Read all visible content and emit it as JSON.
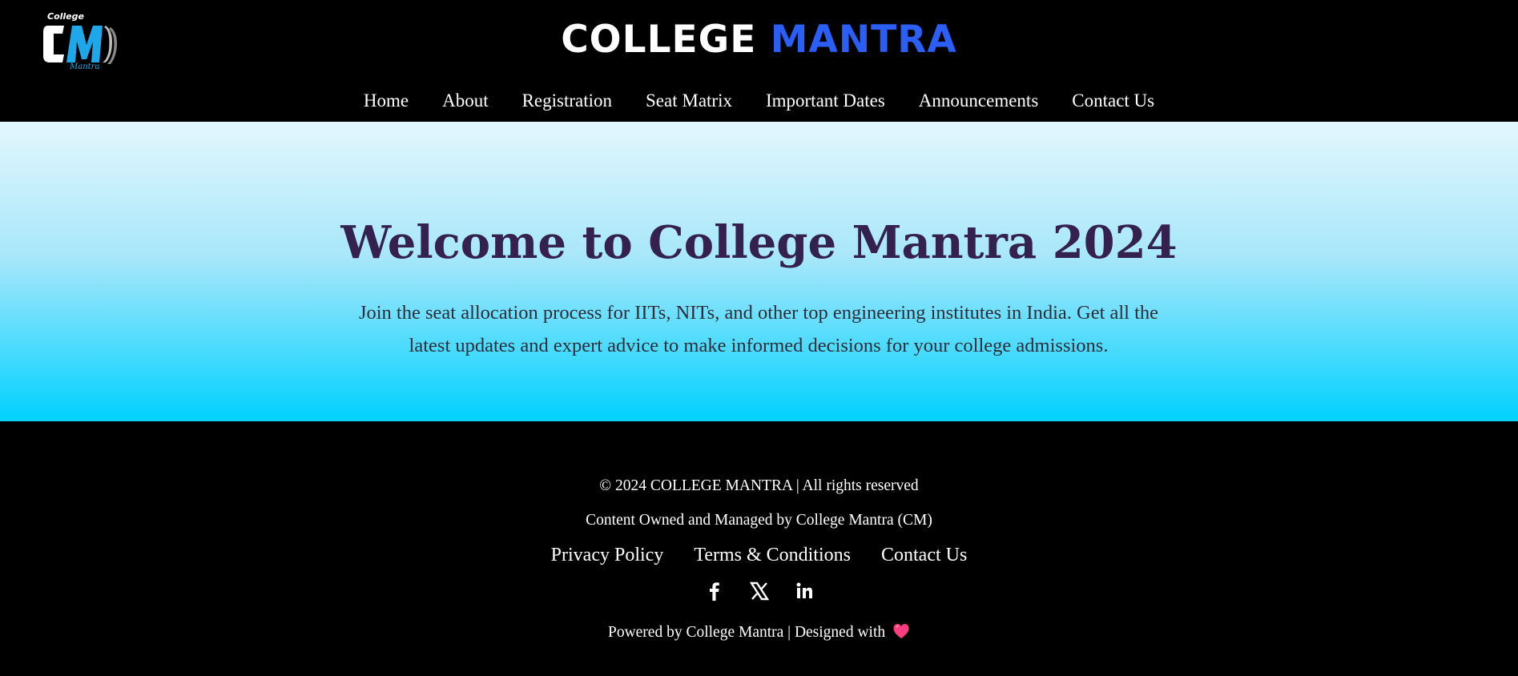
{
  "header": {
    "logo": {
      "small_top": "College",
      "letters": "CM",
      "small_bottom": "Mantra"
    },
    "title_part1": "COLLEGE",
    "title_part2": "MANTRA",
    "nav": [
      {
        "label": "Home"
      },
      {
        "label": "About"
      },
      {
        "label": "Registration"
      },
      {
        "label": "Seat Matrix"
      },
      {
        "label": "Important Dates"
      },
      {
        "label": "Announcements"
      },
      {
        "label": "Contact Us"
      }
    ]
  },
  "hero": {
    "heading": "Welcome to College Mantra 2024",
    "description": "Join the seat allocation process for IITs, NITs, and other top engineering institutes in India. Get all the latest updates and expert advice to make informed decisions for your college admissions."
  },
  "footer": {
    "copyright": "© 2024 COLLEGE MANTRA | All rights reserved",
    "owned": "Content Owned and Managed by College Mantra (CM)",
    "links": [
      {
        "label": "Privacy Policy"
      },
      {
        "label": "Terms & Conditions"
      },
      {
        "label": "Contact Us"
      }
    ],
    "social": [
      {
        "icon": "facebook-icon"
      },
      {
        "icon": "x-icon"
      },
      {
        "icon": "linkedin-icon"
      }
    ],
    "powered": "Powered by College Mantra | Designed with",
    "heart_icon": "heart-icon"
  },
  "colors": {
    "title_accent": "#2a5ef5",
    "hero_heading": "#34214f",
    "hero_gradient_end": "#00d1ff",
    "heart": "#ff3d7f"
  }
}
